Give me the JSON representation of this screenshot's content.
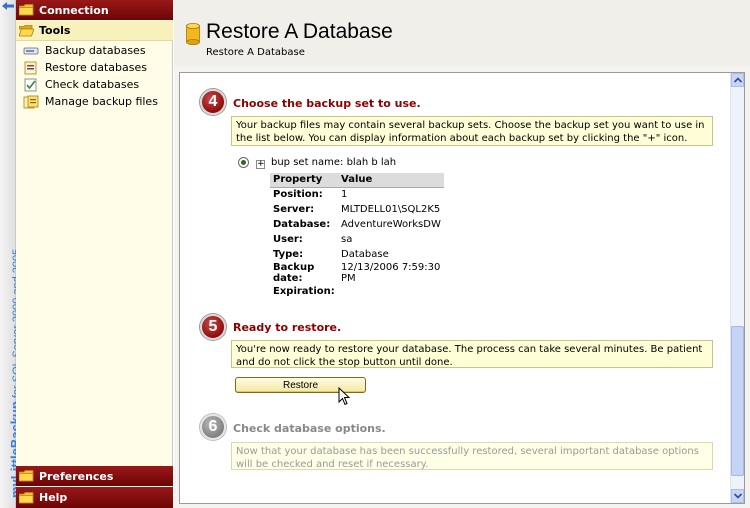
{
  "brand": {
    "name": "myLittleBackup",
    "subtitle": " for SQL Server 2000 and 2005"
  },
  "sidebar": {
    "connection": "Connection",
    "tools": "Tools",
    "items": [
      {
        "label": "Backup databases",
        "icon": "backup-databases-icon"
      },
      {
        "label": "Restore databases",
        "icon": "restore-databases-icon"
      },
      {
        "label": "Check databases",
        "icon": "check-databases-icon"
      },
      {
        "label": "Manage backup files",
        "icon": "manage-backup-files-icon"
      }
    ],
    "preferences": "Preferences",
    "help": "Help"
  },
  "header": {
    "title": "Restore A Database",
    "subtitle": "Restore A Database"
  },
  "step4": {
    "number": "4",
    "title": "Choose the backup set to use.",
    "info": "Your backup files may contain several backup sets. Choose the backup set you want to use in the list below. You can display information about each backup set by clicking the \"+\" icon.",
    "expand_glyph": "+",
    "backup_set_name": "bup set name: blah b lah",
    "table": {
      "headers": [
        "Property",
        "Value"
      ],
      "rows": [
        [
          "Position:",
          "1"
        ],
        [
          "Server:",
          "MLTDELL01\\SQL2K5"
        ],
        [
          "Database:",
          "AdventureWorksDW"
        ],
        [
          "User:",
          "sa"
        ],
        [
          "Type:",
          "Database"
        ],
        [
          "Backup date:",
          "12/13/2006 7:59:30 PM"
        ],
        [
          "Expiration:",
          ""
        ]
      ]
    }
  },
  "step5": {
    "number": "5",
    "title": "Ready to restore.",
    "info": "You're now ready to restore your database. The process can take several minutes. Be patient and do not click the stop button until done.",
    "button": "Restore"
  },
  "step6": {
    "number": "6",
    "title": "Check database options.",
    "info": "Now that your database has been successfully restored, several important database options will be checked and reset if necessary."
  },
  "colors": {
    "accent": "#8b0000",
    "sidebar_bg": "#fffde8",
    "info_bg": "#fffed6",
    "brand_text": "#3a7fcf"
  }
}
